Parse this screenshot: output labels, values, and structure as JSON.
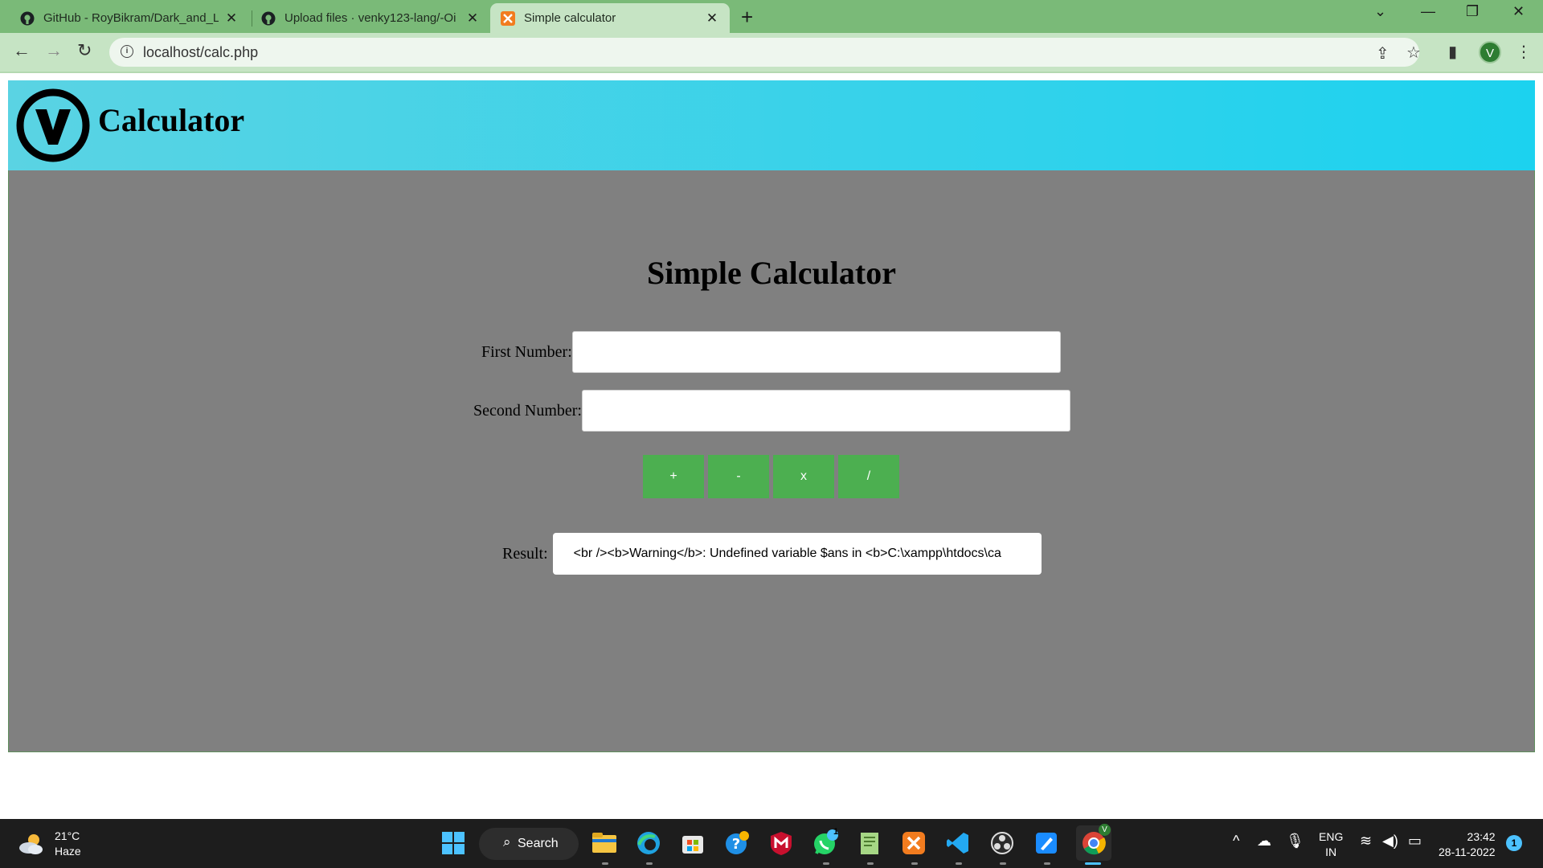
{
  "browser": {
    "tabs": [
      {
        "title": "GitHub - RoyBikram/Dark_and_Li",
        "close": "✕"
      },
      {
        "title": "Upload files · venky123-lang/-Oi",
        "close": "✕"
      },
      {
        "title": "Simple calculator",
        "close": "✕"
      }
    ],
    "new_tab": "+",
    "url": "localhost/calc.php",
    "profile_initial": "V",
    "accent": "#7aba78"
  },
  "page": {
    "header_title": "Calculator",
    "heading": "Simple Calculator",
    "first_label": "First Number:",
    "second_label": "Second Number:",
    "first_value": "",
    "second_value": "",
    "buttons": {
      "add": "+",
      "subtract": "-",
      "multiply": "x",
      "divide": "/"
    },
    "result_label": "Result:",
    "result_value": "<br /><b>Warning</b>:  Undefined variable $ans in <b>C:\\xampp\\htdocs\\ca",
    "header_gradient": [
      "#5ad3e3",
      "#1cd2ef"
    ],
    "panel_color": "#808080",
    "button_color": "#4caf50"
  },
  "taskbar": {
    "temperature": "21°C",
    "weather": "Haze",
    "search_label": "Search",
    "whatsapp_badge": "1",
    "chrome_badge": "V",
    "lang_line1": "ENG",
    "lang_line2": "IN",
    "time": "23:42",
    "date": "28-11-2022",
    "notifications": "1"
  }
}
